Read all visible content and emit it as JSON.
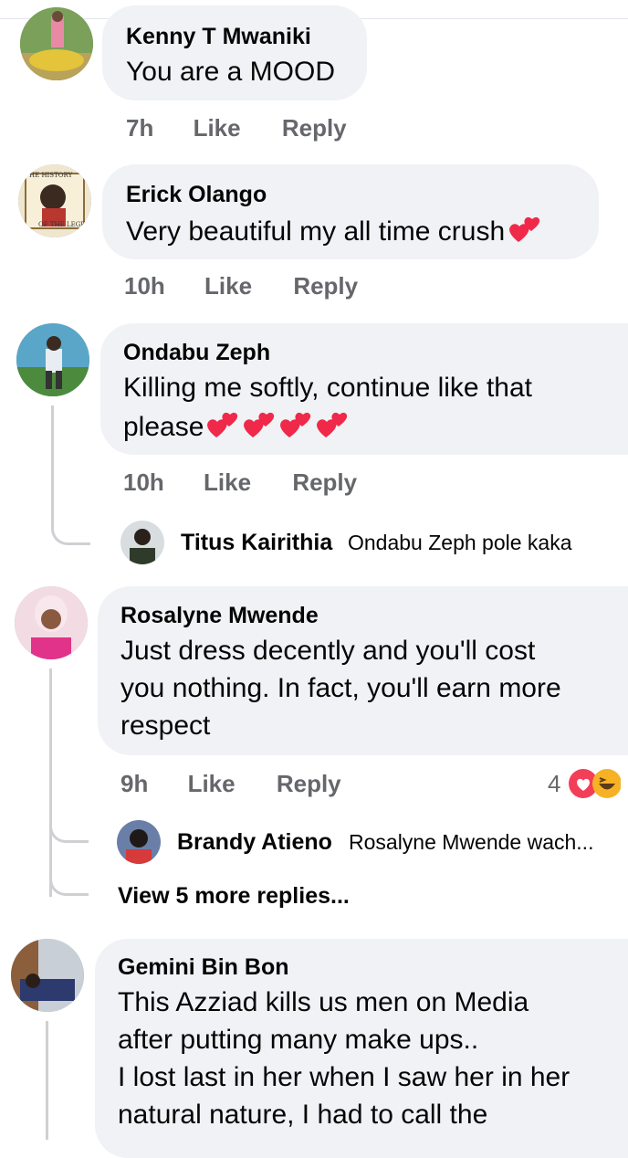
{
  "comments": [
    {
      "name": "Kenny T Mwaniki",
      "text": "You are a MOOD",
      "time": "7h",
      "like": "Like",
      "reply": "Reply"
    },
    {
      "name": "Erick Olango",
      "text": "Very beautiful my all time crush",
      "time": "10h",
      "like": "Like",
      "reply": "Reply"
    },
    {
      "name": "Ondabu Zeph",
      "text_line1": "Killing me softly, continue like that",
      "text_line2": "please",
      "time": "10h",
      "like": "Like",
      "reply": "Reply",
      "reply_preview": {
        "name": "Titus Kairithia",
        "text": "Ondabu Zeph pole kaka"
      }
    },
    {
      "name": "Rosalyne Mwende",
      "text_line1": "Just dress decently and you'll cost",
      "text_line2": "you nothing. In fact, you'll earn more",
      "text_line3": "respect",
      "time": "9h",
      "like": "Like",
      "reply": "Reply",
      "reaction_count": "4",
      "reply_preview": {
        "name": "Brandy Atieno",
        "text": "Rosalyne Mwende wach..."
      },
      "view_more": "View 5 more replies..."
    },
    {
      "name": "Gemini Bin Bon",
      "text_line1": "This Azziad kills us men on Media",
      "text_line2": "after putting many make ups..",
      "text_line3": "I lost last in her when I saw her in her",
      "text_line4": "natural nature, I had to call the"
    }
  ],
  "colors": {
    "bubble": "#f0f2f5",
    "meta": "#65676b",
    "text": "#050505",
    "heart": "#f33e58",
    "haha": "#f7b125"
  }
}
